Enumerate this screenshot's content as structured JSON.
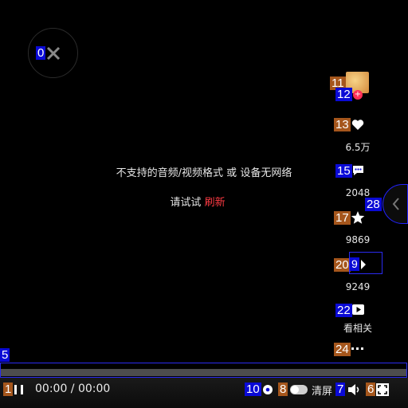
{
  "overlay_tags": {
    "close": "0",
    "play": "1",
    "progress": "5",
    "toggle": "8",
    "volume": "7",
    "settings": "10",
    "fullscreen": "6",
    "avatar": "11",
    "follow": "12",
    "like": "13",
    "comment": "15",
    "favorite": "17",
    "share": "20",
    "related": "22",
    "more": "24",
    "collapse": "28",
    "share_inner": "9"
  },
  "player": {
    "error_message": "不支持的音频/视频格式 或 设备无网络",
    "retry_prefix": "请试试",
    "retry_link": "刷新",
    "time_text": "00:00 / 00:00",
    "clear_label": "清屏",
    "progress_fraction": 0
  },
  "sidebar": {
    "like_count": "6.5万",
    "comment_count": "2048",
    "favorite_count": "9869",
    "share_count": "9249",
    "related_label": "看相关"
  },
  "colors": {
    "refresh_link": "#ff3b43",
    "follow_badge": "#ff2f56",
    "tag_blue": "#0a0ad6",
    "tag_brown": "#a5561c"
  }
}
